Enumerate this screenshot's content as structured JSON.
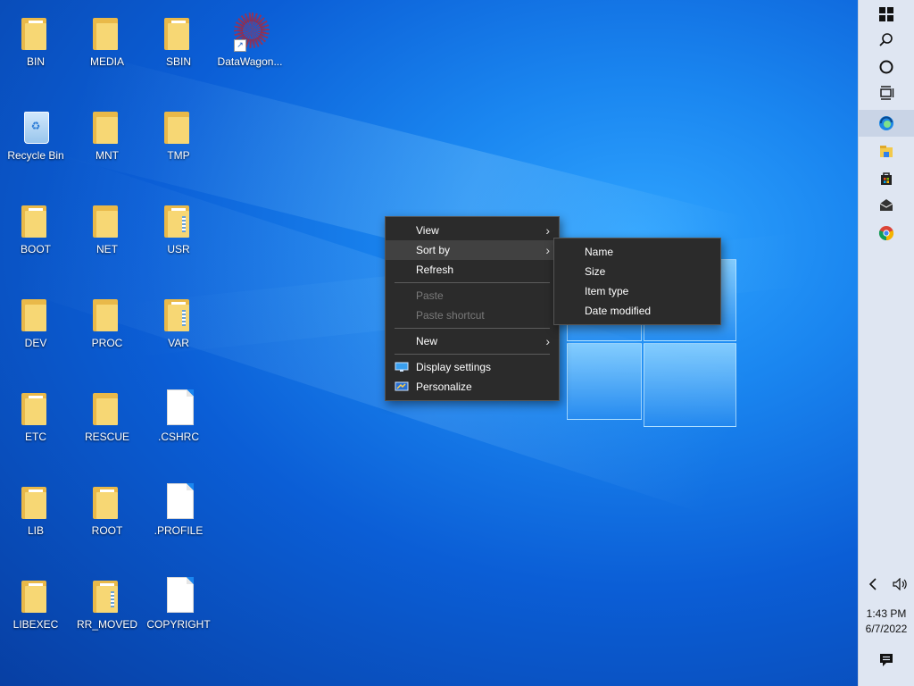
{
  "desktop": {
    "icons": [
      {
        "label": "BIN",
        "type": "folder"
      },
      {
        "label": "MEDIA",
        "type": "folder"
      },
      {
        "label": "SBIN",
        "type": "folder"
      },
      {
        "label": "DataWagon...",
        "type": "shortcut"
      },
      {
        "label": "Recycle Bin",
        "type": "recycle-bin"
      },
      {
        "label": "MNT",
        "type": "folder"
      },
      {
        "label": "TMP",
        "type": "folder"
      },
      {
        "label": "BOOT",
        "type": "folder"
      },
      {
        "label": "NET",
        "type": "folder"
      },
      {
        "label": "USR",
        "type": "folder"
      },
      {
        "label": "DEV",
        "type": "folder"
      },
      {
        "label": "PROC",
        "type": "folder"
      },
      {
        "label": "VAR",
        "type": "folder"
      },
      {
        "label": "ETC",
        "type": "folder"
      },
      {
        "label": "RESCUE",
        "type": "folder"
      },
      {
        "label": ".CSHRC",
        "type": "file"
      },
      {
        "label": "LIB",
        "type": "folder"
      },
      {
        "label": "ROOT",
        "type": "folder"
      },
      {
        "label": ".PROFILE",
        "type": "file"
      },
      {
        "label": "LIBEXEC",
        "type": "folder"
      },
      {
        "label": "RR_MOVED",
        "type": "folder"
      },
      {
        "label": "COPYRIGHT",
        "type": "file"
      }
    ]
  },
  "context_menu": {
    "items": [
      {
        "label": "View",
        "submenu": true
      },
      {
        "label": "Sort by",
        "submenu": true,
        "highlighted": true
      },
      {
        "label": "Refresh"
      },
      {
        "label": "Paste",
        "disabled": true
      },
      {
        "label": "Paste shortcut",
        "disabled": true
      },
      {
        "label": "New",
        "submenu": true
      },
      {
        "label": "Display settings",
        "icon": "display-icon"
      },
      {
        "label": "Personalize",
        "icon": "personalize-icon"
      }
    ]
  },
  "sort_submenu": {
    "items": [
      {
        "label": "Name"
      },
      {
        "label": "Size"
      },
      {
        "label": "Item type"
      },
      {
        "label": "Date modified"
      }
    ]
  },
  "taskbar": {
    "icons": [
      "windows-start-icon",
      "search-icon",
      "cortana-icon",
      "task-view-icon",
      "edge-icon",
      "file-explorer-icon",
      "store-icon",
      "mail-icon",
      "chrome-icon"
    ],
    "tray": {
      "chevron": "chevron-left-icon",
      "volume": "volume-icon"
    },
    "time": "1:43 PM",
    "date": "6/7/2022",
    "notification": "action-center-icon"
  },
  "colors": {
    "desktop_bg": "#0b5ed6",
    "menu_bg": "#2b2b2b",
    "taskbar_bg": "#dfe6f2"
  }
}
